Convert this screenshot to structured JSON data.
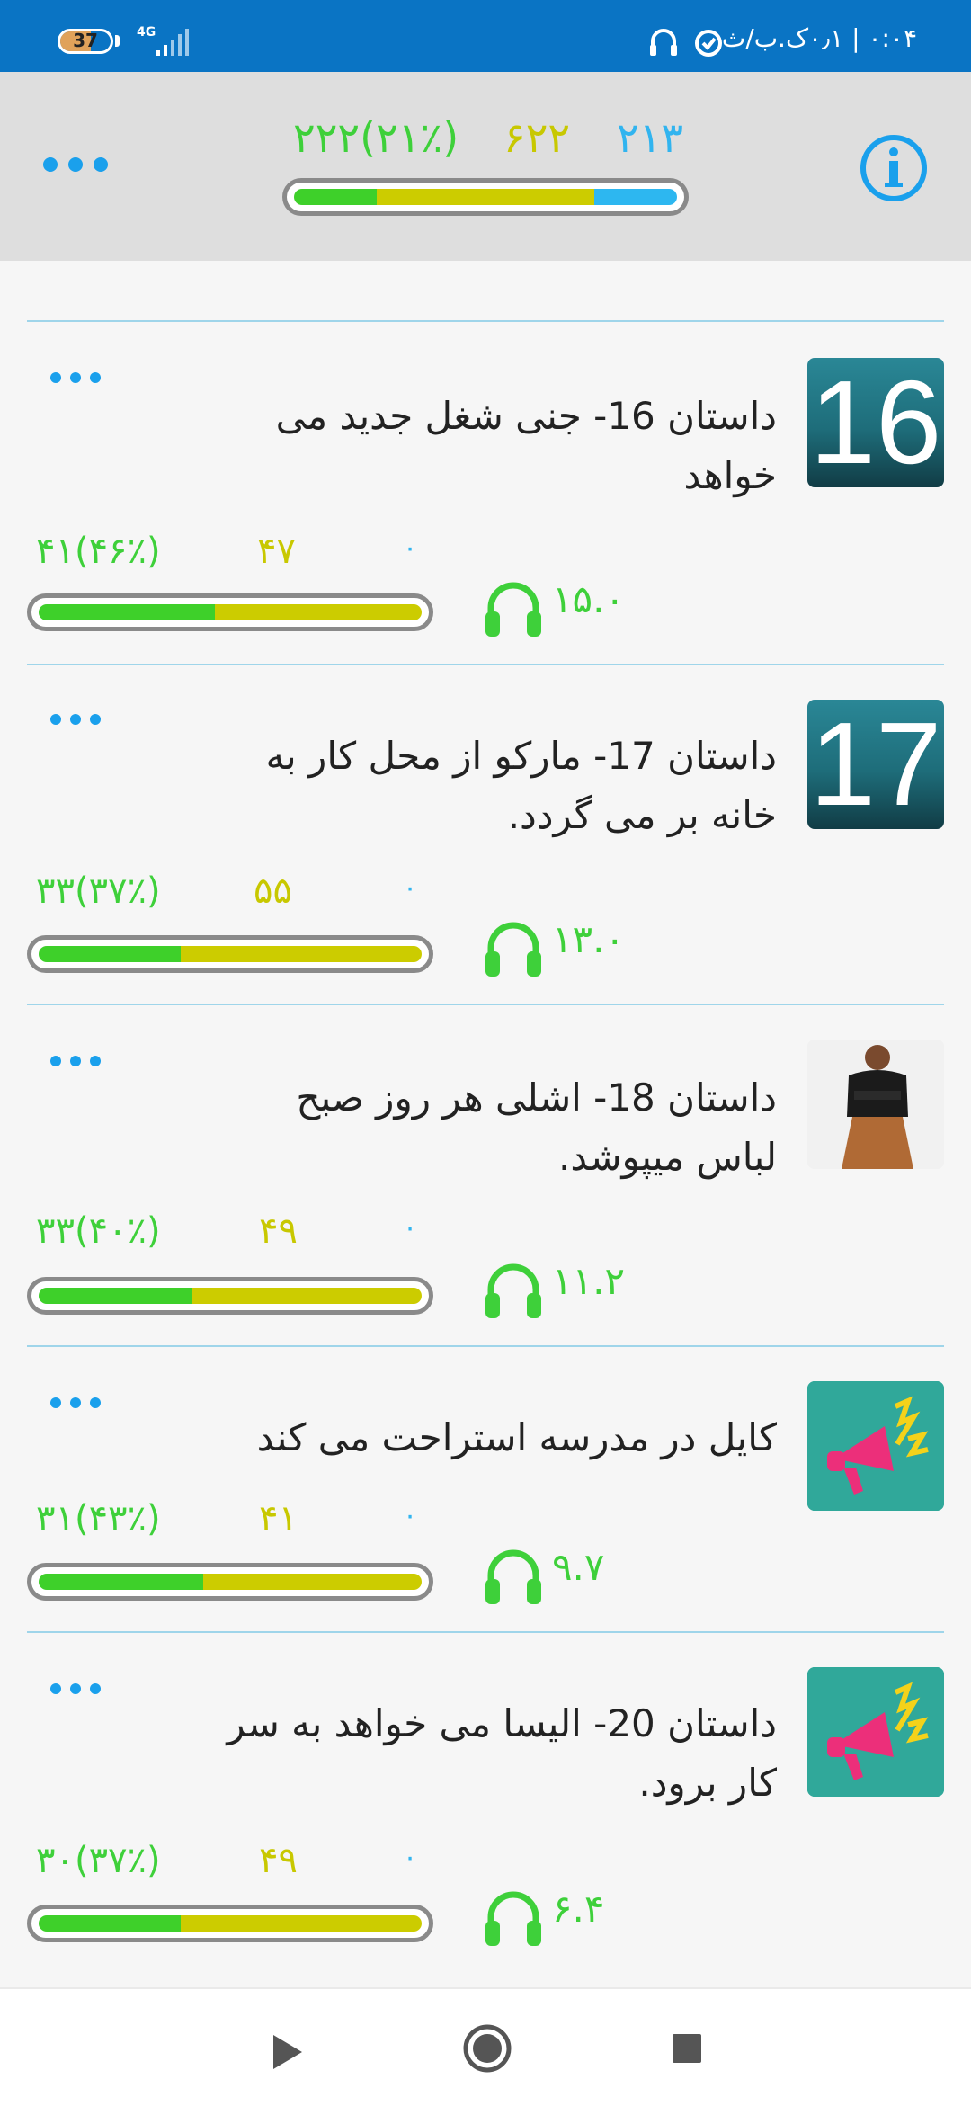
{
  "status_bar": {
    "battery": "37",
    "network": "4G",
    "time": "۰:۰۴ | ۰٫۱ک.ب/ث"
  },
  "header": {
    "stats": {
      "green": "۲۲۲(۲۱٪)",
      "yellow": "۶۲۲",
      "blue": "۲۱۳"
    },
    "progress": {
      "green": 0.21,
      "yellow": 0.55,
      "blue": 0.21
    },
    "info_icon": "info-icon",
    "more_icon": "more-icon"
  },
  "stories": [
    {
      "thumb_type": "number",
      "thumb_text": "16",
      "title": "داستان 16- جنی شغل جدید می خواهد",
      "stat_green": "۴۱(۴۶٪)",
      "stat_yellow": "۴۷",
      "stat_blue": "۰",
      "progress_green": 0.46,
      "duration": "۱۵.۰"
    },
    {
      "thumb_type": "number",
      "thumb_text": "17",
      "title": "داستان 17- مارکو از محل کار به خانه بر می گردد.",
      "stat_green": "۳۳(۳۷٪)",
      "stat_yellow": "۵۵",
      "stat_blue": "۰",
      "progress_green": 0.37,
      "duration": "۱۳.۰"
    },
    {
      "thumb_type": "photo",
      "thumb_text": "",
      "title": "داستان 18- اشلی هر روز صبح لباس میپوشد.",
      "stat_green": "۳۳(۴۰٪)",
      "stat_yellow": "۴۹",
      "stat_blue": "۰",
      "progress_green": 0.4,
      "duration": "۱۱.۲"
    },
    {
      "thumb_type": "megaphone",
      "thumb_text": "",
      "title": "کایل در مدرسه استراحت می کند",
      "stat_green": "۳۱(۴۳٪)",
      "stat_yellow": "۴۱",
      "stat_blue": "۰",
      "progress_green": 0.43,
      "duration": "۹.۷"
    },
    {
      "thumb_type": "megaphone",
      "thumb_text": "",
      "title": "داستان 20- الیسا می خواهد به سر کار برود.",
      "stat_green": "۳۰(۳۷٪)",
      "stat_yellow": "۴۹",
      "stat_blue": "۰",
      "progress_green": 0.37,
      "duration": "۶.۴"
    }
  ],
  "player": {
    "icons": [
      "play-icon",
      "record-icon",
      "stop-icon"
    ]
  },
  "colors": {
    "status_bar": "#0a74c4",
    "green": "#3ed03a",
    "yellow": "#c8c800",
    "blue": "#31b4ef"
  }
}
